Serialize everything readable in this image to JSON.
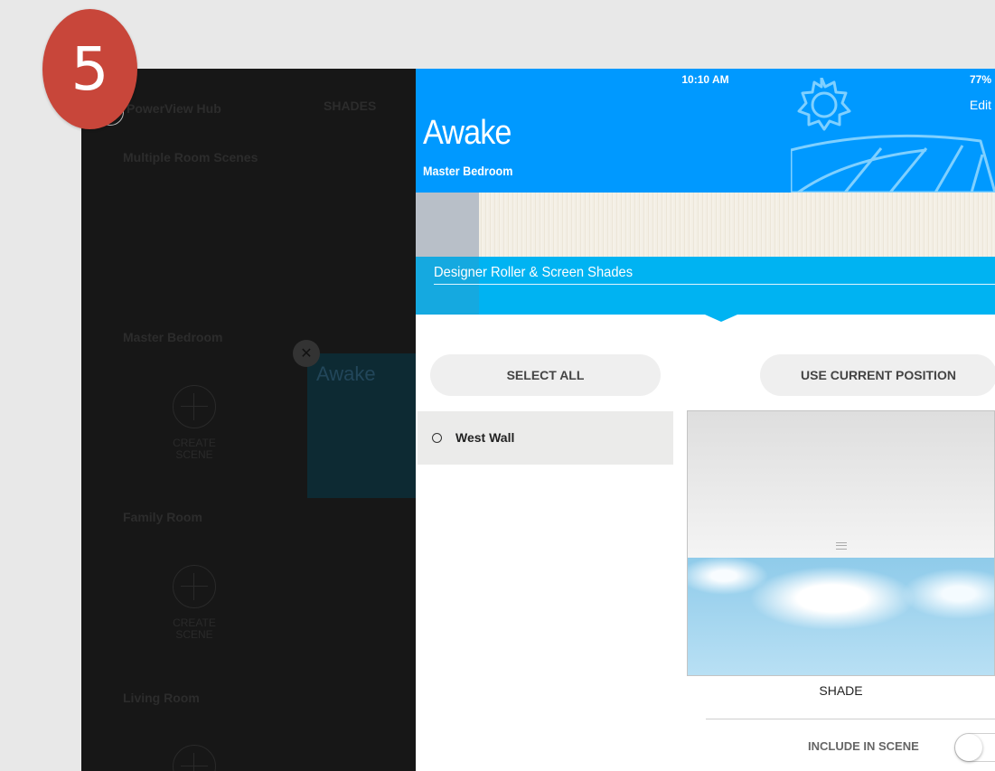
{
  "step_badge": "5",
  "background_app": {
    "hub_name": "PowerView Hub",
    "nav_tab": "SHADES",
    "sections": [
      {
        "title": "Multiple Room Scenes"
      },
      {
        "title": "Master Bedroom",
        "create_label": "CREATE SCENE",
        "tile_title": "Awake"
      },
      {
        "title": "Family Room",
        "create_label": "CREATE SCENE"
      },
      {
        "title": "Living Room"
      }
    ]
  },
  "status_bar": {
    "time": "10:10 AM",
    "battery": "77%"
  },
  "header": {
    "edit_label": "Edit",
    "scene_title": "Awake",
    "room": "Master Bedroom",
    "color": "#0099ff"
  },
  "shade_type": "Designer Roller & Screen Shades",
  "buttons": {
    "select_all": "SELECT ALL",
    "use_current_position": "USE CURRENT POSITION"
  },
  "shades": [
    {
      "name": "West Wall",
      "selected": false
    }
  ],
  "preview": {
    "label": "SHADE"
  },
  "include_in_scene": {
    "label": "INCLUDE IN SCENE",
    "enabled": false
  },
  "icons": {
    "scene": "sun-over-field-icon",
    "close": "close-icon",
    "add": "plus-icon"
  }
}
